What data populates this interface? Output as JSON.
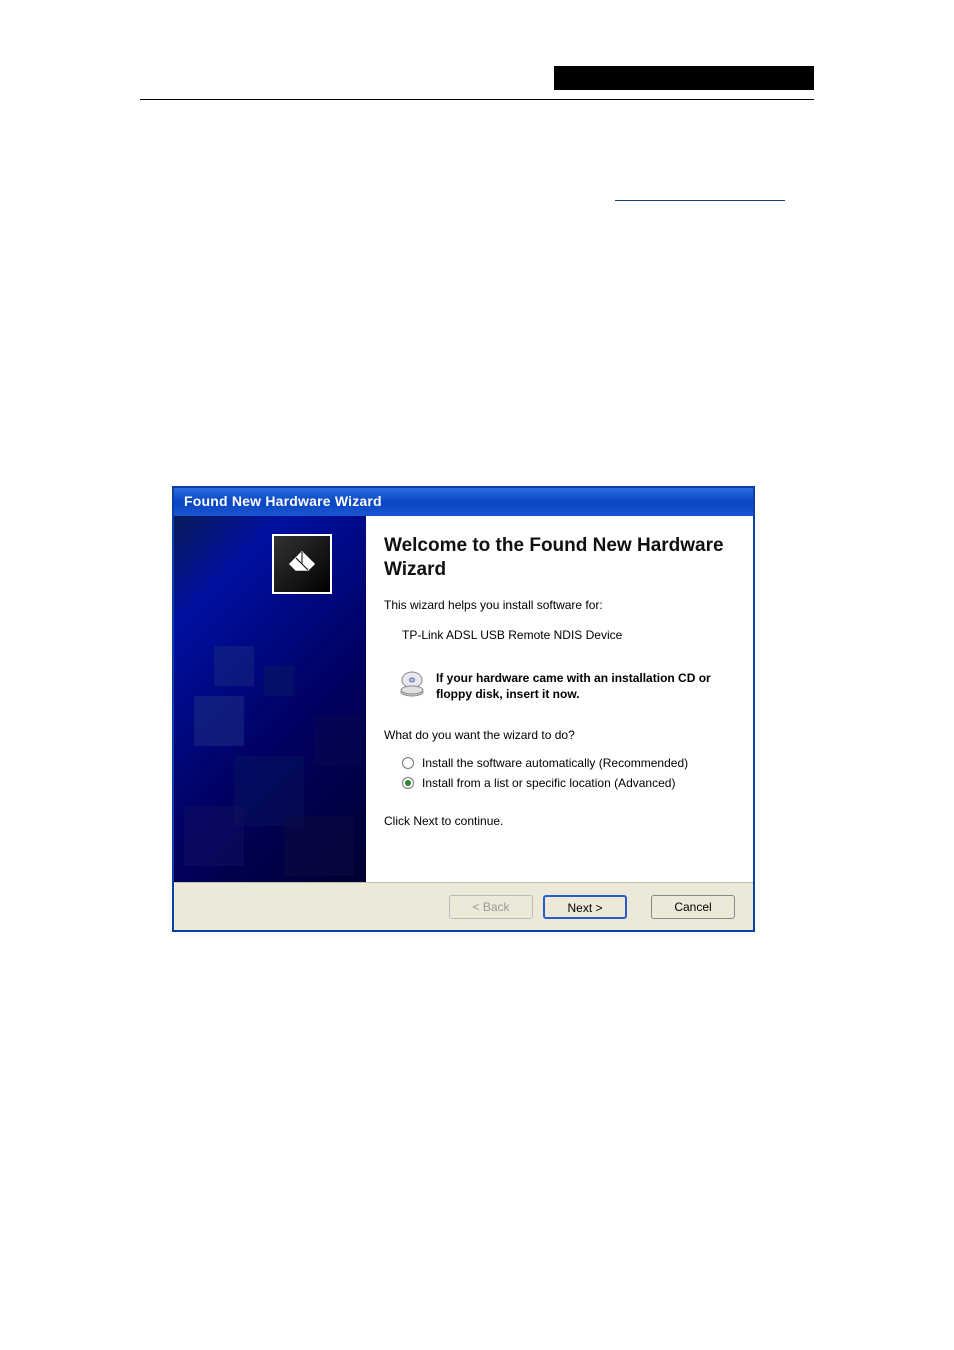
{
  "dialog": {
    "title": "Found New Hardware Wizard",
    "welcome": "Welcome to the Found New Hardware Wizard",
    "helptext": "This wizard helps you install software for:",
    "device": "TP-Link ADSL USB Remote NDIS Device",
    "cd_hint": "If your hardware came with an installation CD or floppy disk, insert it now.",
    "prompt": "What do you want the wizard to do?",
    "options": {
      "auto": "Install the software automatically (Recommended)",
      "advanced": "Install from a list or specific location (Advanced)"
    },
    "selected": "advanced",
    "continue": "Click Next to continue.",
    "buttons": {
      "back": "< Back",
      "next": "Next >",
      "cancel": "Cancel"
    }
  }
}
